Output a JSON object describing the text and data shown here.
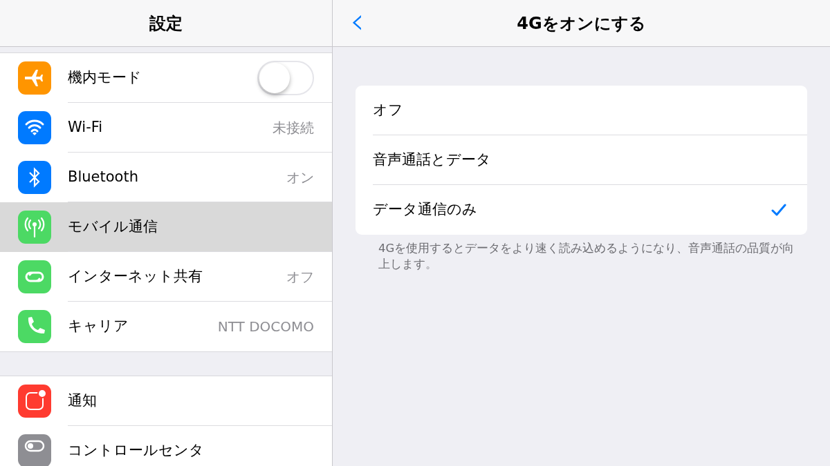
{
  "sidebar": {
    "title": "設定",
    "groups": [
      {
        "items": [
          {
            "label": "機内モード",
            "kind": "toggle",
            "on": false,
            "color": "#ff9500",
            "selected": false
          },
          {
            "label": "Wi-Fi",
            "kind": "value",
            "value": "未接続",
            "color": "#007aff",
            "selected": false
          },
          {
            "label": "Bluetooth",
            "kind": "value",
            "value": "オン",
            "color": "#007aff",
            "selected": false
          },
          {
            "label": "モバイル通信",
            "kind": "plain",
            "color": "#4cd964",
            "selected": true
          },
          {
            "label": "インターネット共有",
            "kind": "value",
            "value": "オフ",
            "color": "#4cd964",
            "selected": false
          },
          {
            "label": "キャリア",
            "kind": "value",
            "value": "NTT DOCOMO",
            "color": "#4cd964",
            "selected": false
          }
        ]
      },
      {
        "items": [
          {
            "label": "通知",
            "kind": "plain",
            "color": "#ff3b30",
            "selected": false
          },
          {
            "label": "コントロールセンタ",
            "kind": "plain",
            "color": "#8e8e93",
            "selected": false
          }
        ]
      }
    ]
  },
  "detail": {
    "back": "‹",
    "title": "4Gをオンにする",
    "options": [
      {
        "label": "オフ",
        "selected": false
      },
      {
        "label": "音声通話とデータ",
        "selected": false
      },
      {
        "label": "データ通信のみ",
        "selected": true
      }
    ],
    "footnote": "4Gを使用するとデータをより速く読み込めるようになり、音声通話の品質が向上します。"
  }
}
